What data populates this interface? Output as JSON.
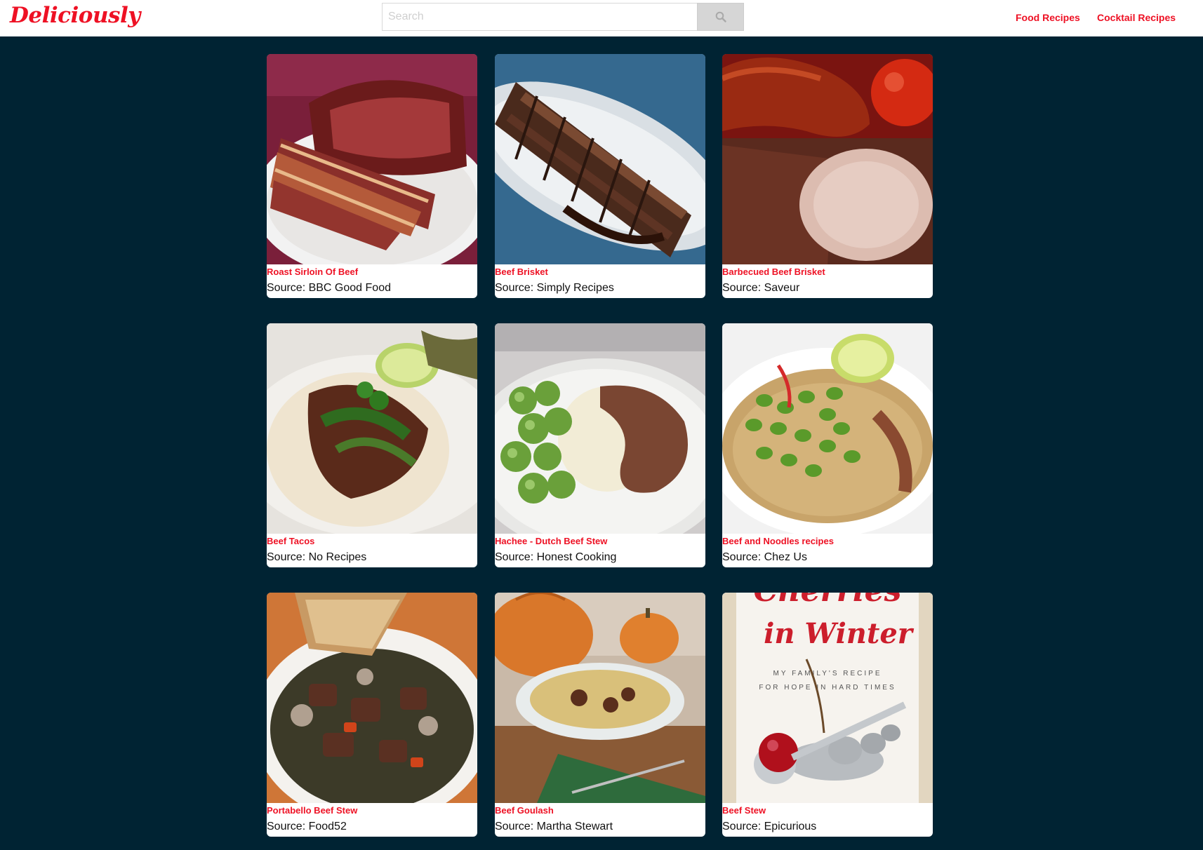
{
  "header": {
    "logo": "Deliciously",
    "search_placeholder": "Search",
    "search_icon": "search-icon",
    "nav": [
      "Food Recipes",
      "Cocktail Recipes"
    ]
  },
  "accent_color": "#ee1124",
  "background_color": "#002333",
  "recipes": [
    {
      "title": "Roast Sirloin Of Beef",
      "source": "Source: BBC Good Food"
    },
    {
      "title": "Beef Brisket",
      "source": "Source: Simply Recipes"
    },
    {
      "title": "Barbecued Beef Brisket",
      "source": "Source: Saveur"
    },
    {
      "title": "Beef Tacos",
      "source": "Source: No Recipes"
    },
    {
      "title": "Hachee - Dutch Beef Stew",
      "source": "Source: Honest Cooking"
    },
    {
      "title": "Beef and Noodles recipes",
      "source": "Source: Chez Us"
    },
    {
      "title": "Portabello Beef Stew",
      "source": "Source: Food52"
    },
    {
      "title": "Beef Goulash",
      "source": "Source: Martha Stewart"
    },
    {
      "title": "Beef Stew",
      "source": "Source: Epicurious",
      "image_text": [
        "Cherries",
        "in Winter",
        "MY FAMILY'S RECIPE",
        "FOR HOPE IN HARD TIMES"
      ]
    }
  ]
}
